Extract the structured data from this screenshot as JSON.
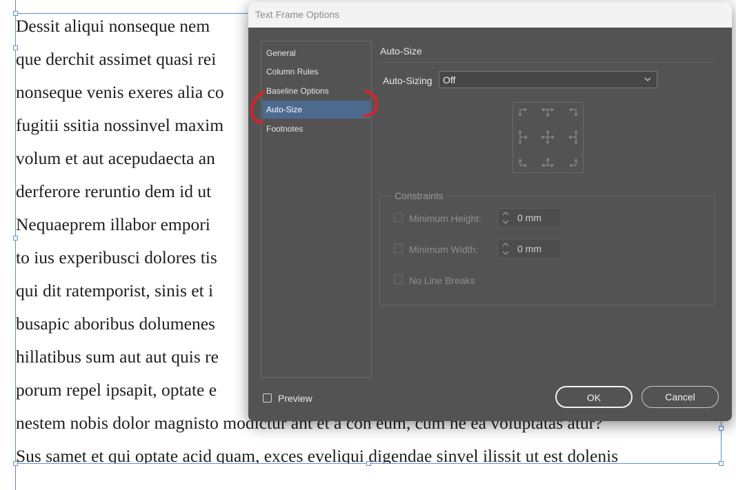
{
  "document": {
    "lines": [
      "Dessit aliqui nonseque nem",
      "que derchit assimet quasi rei",
      "nonseque venis exeres alia co",
      "fugitii ssitia nossinvel maxim",
      "volum et aut acepudaecta an",
      "derferore reruntio dem id ut",
      "Nequaeprem illabor empori",
      "to ius experibusci dolores tis",
      "qui dit ratemporist, sinis et i",
      "busapic aboribus dolumenes",
      "hillatibus sum aut aut quis re",
      "porum repel ipsapit, optate e",
      "nestem nobis dolor magnisto modictur ant et a con eum, cum ne ea voluptatas atur?",
      "Sus samet et qui optate acid quam, exces eveliqui digendae sinvel ilissit ut est dolenis"
    ]
  },
  "dialog": {
    "title": "Text Frame Options",
    "nav": [
      {
        "label": "General",
        "selected": false
      },
      {
        "label": "Column Rules",
        "selected": false
      },
      {
        "label": "Baseline Options",
        "selected": false
      },
      {
        "label": "Auto-Size",
        "selected": true
      },
      {
        "label": "Footnotes",
        "selected": false
      }
    ],
    "section_title": "Auto-Size",
    "auto_sizing": {
      "label": "Auto-Sizing",
      "value": "Off"
    },
    "constraints": {
      "title": "Constraints",
      "min_height": {
        "label": "Minimum Height:",
        "value": "0 mm",
        "checked": false
      },
      "min_width": {
        "label": "Minimum Width:",
        "value": "0 mm",
        "checked": false
      },
      "no_line_breaks": {
        "label": "No Line Breaks",
        "checked": false
      }
    },
    "preview": {
      "label": "Preview",
      "checked": false
    },
    "ok_label": "OK",
    "cancel_label": "Cancel"
  },
  "colors": {
    "dialog_bg": "#535353",
    "selected_nav": "#4b6a8e",
    "frame_edge": "#5b8fd6",
    "margin_guide": "#b15ad1",
    "annotation": "#d8232a"
  }
}
